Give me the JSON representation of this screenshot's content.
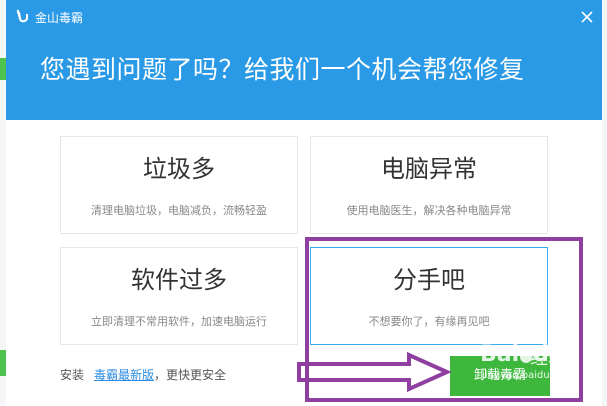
{
  "app": {
    "title": "金山毒霸"
  },
  "headline": "您遇到问题了吗？给我们一个机会帮您修复",
  "options": [
    {
      "title": "垃圾多",
      "desc": "清理电脑垃圾，电脑减负，流畅轻盈"
    },
    {
      "title": "电脑异常",
      "desc": "使用电脑医生，解决各种电脑异常"
    },
    {
      "title": "软件过多",
      "desc": "立即清理不常用软件，加速电脑运行"
    },
    {
      "title": "分手吧",
      "desc": "不想要你了，有缘再见吧"
    }
  ],
  "footer": {
    "prefix": "安装",
    "link": "毒霸最新版",
    "suffix": "，更快更安全"
  },
  "download_button": "卸载毒霸",
  "watermark": {
    "brand": "Bai",
    "brand_suffix": "du",
    "product": "经验",
    "url": "jingyan.baidu.com"
  },
  "colors": {
    "header": "#2b9ae6",
    "accent_green": "#3db83d",
    "annotation_purple": "#8e3fa0"
  },
  "icons": {
    "logo": "kingsoft-logo-icon",
    "close": "close-icon"
  }
}
